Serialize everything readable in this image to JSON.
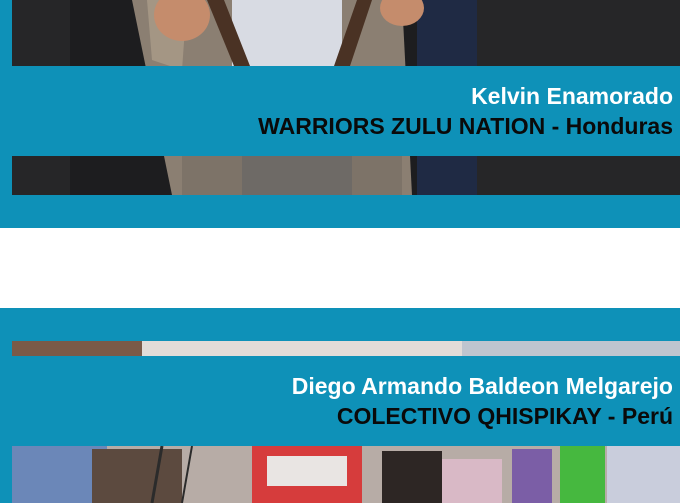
{
  "profiles": [
    {
      "name": "Kelvin Enamorado",
      "team": "WARRIORS ZULU NATION - Honduras"
    },
    {
      "name": "Diego Armando Baldeon Melgarejo",
      "team": "COLECTIVO QHISPIKAY - Perú"
    }
  ],
  "colors": {
    "card_background": "#0e91b8",
    "name_text": "#ffffff",
    "team_text": "#0a0a0a"
  }
}
